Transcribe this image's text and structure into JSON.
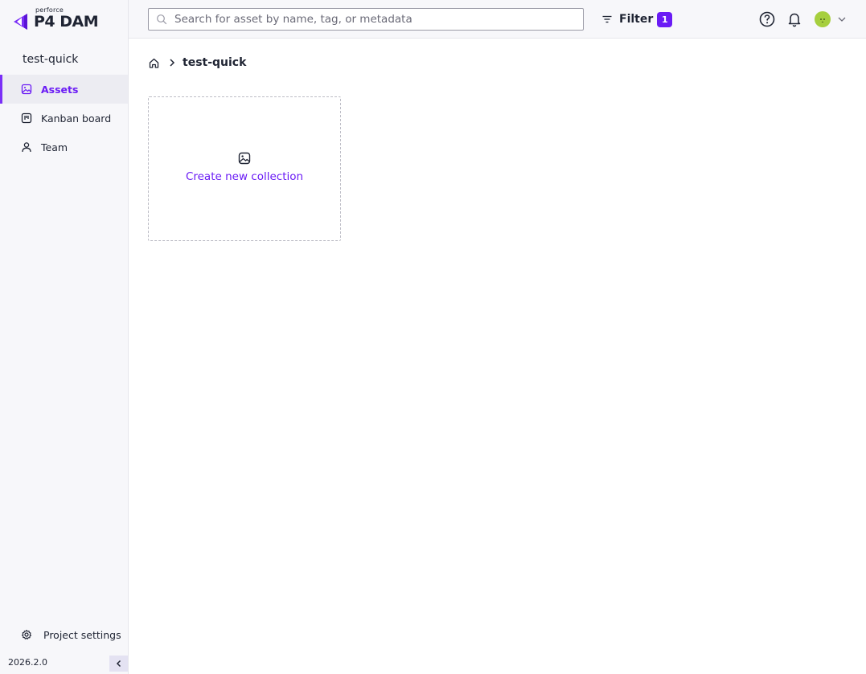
{
  "app": {
    "logo_small": "perforce",
    "logo_main": "P4 DAM",
    "accent_color": "#6a1bf5"
  },
  "sidebar": {
    "project_name": "test-quick",
    "items": [
      {
        "label": "Assets",
        "icon": "image-icon",
        "active": true
      },
      {
        "label": "Kanban board",
        "icon": "kanban-icon",
        "active": false
      },
      {
        "label": "Team",
        "icon": "user-icon",
        "active": false
      }
    ],
    "settings_label": "Project settings",
    "version": "2026.2.0"
  },
  "topbar": {
    "search_placeholder": "Search for asset by name, tag, or metadata",
    "filter_label": "Filter",
    "filter_count": "1"
  },
  "main": {
    "breadcrumb": [
      "test-quick"
    ],
    "create_collection_label": "Create new collection"
  }
}
